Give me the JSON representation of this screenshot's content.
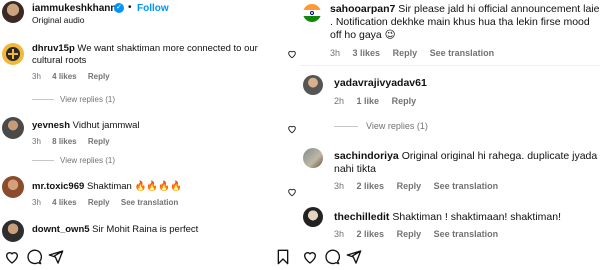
{
  "header": {
    "username": "iammukeshkhanna",
    "follow_label": "Follow",
    "subtitle": "Original audio"
  },
  "left_comments": [
    {
      "username": "dhruv15p",
      "text": "We want shaktiman more connected to our cultural roots",
      "time": "3h",
      "likes": "4 likes",
      "reply": "Reply",
      "view_replies": "View replies (1)"
    },
    {
      "username": "yevnesh",
      "text": "Vidhut jammwal",
      "time": "3h",
      "likes": "8 likes",
      "reply": "Reply",
      "view_replies": "View replies (1)"
    },
    {
      "username": "mr.toxic969",
      "text": "Shaktiman 🔥🔥🔥🔥",
      "time": "3h",
      "likes": "4 likes",
      "reply": "Reply",
      "translation": "See translation"
    },
    {
      "username": "downt_own5",
      "text": "Sir Mohit Raina is perfect"
    }
  ],
  "right_comments": [
    {
      "username": "sahooarpan7",
      "text": "Sir please jald hi official announcement laie . Notification dekhke main khus hua tha lekin firse mood off ho gaya 😉",
      "time": "3h",
      "likes": "3 likes",
      "reply": "Reply",
      "translation": "See translation"
    },
    {
      "username": "yadavrajivyadav61",
      "text": "",
      "time": "2h",
      "likes": "1 like",
      "reply": "Reply",
      "view_replies": "View replies (1)"
    },
    {
      "username": "sachindoriya",
      "text": "Original original hi rahega. duplicate jyada nahi tikta",
      "time": "3h",
      "likes": "2 likes",
      "reply": "Reply",
      "translation": "See translation"
    },
    {
      "username": "thechilledit",
      "text": "Shaktiman ! shaktimaan! shaktiman!",
      "time": "3h",
      "likes": "2 likes",
      "reply": "Reply",
      "translation": "See translation"
    }
  ],
  "action_bar": {
    "icons": [
      "heart-icon",
      "comment-icon",
      "share-icon",
      "save-icon"
    ]
  },
  "colors": {
    "follow": "#0095f6",
    "meta": "#737373",
    "verified": "#0095f6"
  }
}
